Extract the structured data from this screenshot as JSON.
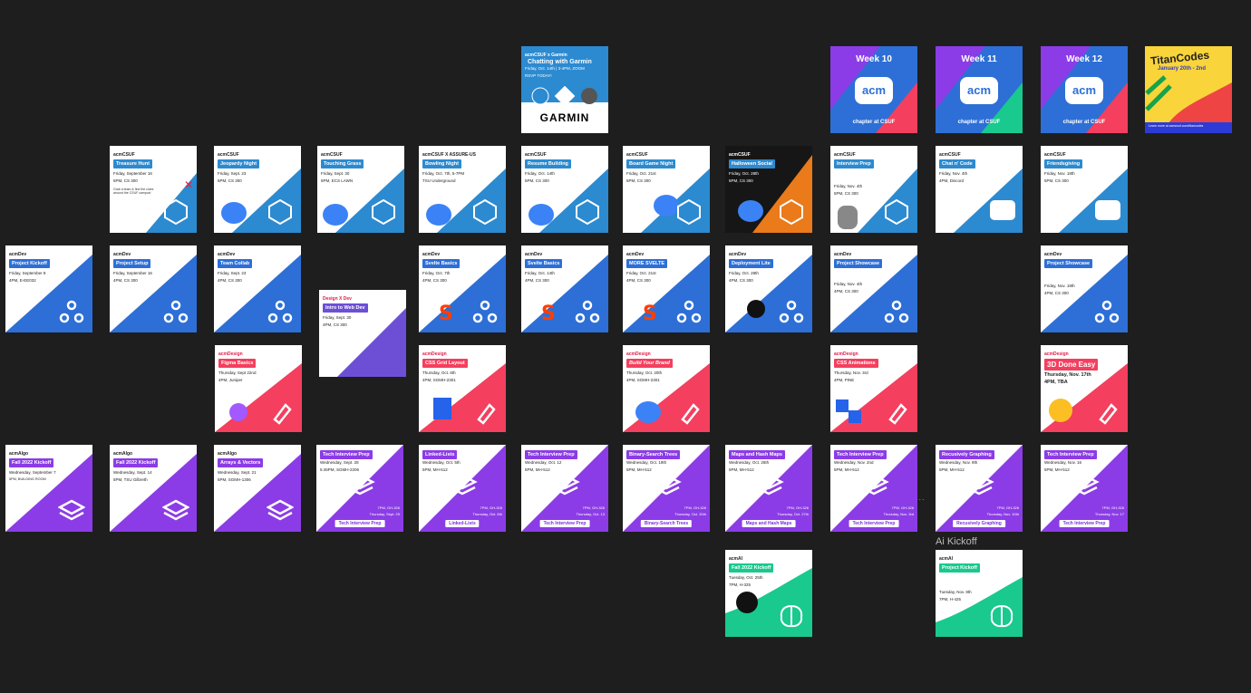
{
  "canvas": {
    "background": "#1e1e1e"
  },
  "selection_label": "Ai Kickoff",
  "more_indicator": "...",
  "colors": {
    "csuf": "#2c8ad0",
    "dev": "#2d6fd6",
    "design": "#f43f5e",
    "algo": "#8b3ce6",
    "ai": "#19c98d"
  },
  "frames": {
    "garmin": {
      "hdr": "acmCSUF x Garmin",
      "title": "Chatting with Garmin",
      "l1": "Friday, Oct. 14th | 3-4PM, ZOOM",
      "l2": "RSVP TODAY!",
      "brand": "GARMIN"
    },
    "week10": {
      "week": "Week 10",
      "mark": "acm",
      "chapter": "chapter at CSUF"
    },
    "week11": {
      "week": "Week 11",
      "mark": "acm",
      "chapter": "chapter at CSUF"
    },
    "week12": {
      "week": "Week 12",
      "mark": "acm",
      "chapter": "chapter at CSUF"
    },
    "titancodes": {
      "title": "TitanCodes",
      "sub": "January 20th - 2nd",
      "cap": "Learn more at acmcsuf.com/titancodes"
    },
    "csuf1": {
      "hdr": "acmCSUF",
      "title": "Treasure Hunt",
      "l1": "Friday, September 16",
      "l2": "5PM, CS 300",
      "l3": "Grab a team & find the clues around the CSUF campus!"
    },
    "csuf2": {
      "hdr": "acmCSUF",
      "title": "Jeopardy Night",
      "l1": "Friday, Sept. 23",
      "l2": "5PM, CS 300"
    },
    "csuf3": {
      "hdr": "acmCSUF",
      "title": "Touching Grass",
      "l1": "Friday, Sept. 30",
      "l2": "5PM, ECS LAWN"
    },
    "csuf4": {
      "hdr": "acmCSUF X ASSURE-US",
      "title": "Bowling Night",
      "l1": "Friday, Oct. 7th, 5-7PM",
      "l2": "TSU Underground"
    },
    "csuf5": {
      "hdr": "acmCSUF",
      "title": "Resume Building",
      "l1": "Friday, Oct. 14th",
      "l2": "5PM, CS 300"
    },
    "csuf6": {
      "hdr": "acmCSUF",
      "title": "Board Game Night",
      "l1": "Friday, Oct. 21st",
      "l2": "5PM, CS 300"
    },
    "csuf7": {
      "hdr": "acmCSUF",
      "title": "Halloween Social",
      "l1": "Friday, Oct. 28th",
      "l2": "5PM, CS 300"
    },
    "csuf8": {
      "hdr": "acmCSUF",
      "title": "Interview Prep",
      "l1": "Friday, Nov. 4th",
      "l2": "5PM, CS 300"
    },
    "csuf9": {
      "hdr": "acmCSUF",
      "title": "Chat n' Code",
      "l1": "Friday, Nov. 4th",
      "l2": "4PM, Discord"
    },
    "csuf10": {
      "hdr": "acmCSUF",
      "title": "Friendsgiving",
      "l1": "Friday, Nov. 18th",
      "l2": "5PM, CS 300"
    },
    "dev1": {
      "hdr": "acmDev",
      "title": "Project Kickoff",
      "l1": "Friday, September 9",
      "l2": "4PM, E-EE032"
    },
    "dev2": {
      "hdr": "acmDev",
      "title": "Project Setup",
      "l1": "Friday, September 16",
      "l2": "4PM, CS 300"
    },
    "dev3": {
      "hdr": "acmDev",
      "title": "Team Collab",
      "l1": "Friday, Sept. 23",
      "l2": "4PM, CS 300"
    },
    "dev4": {
      "hdr": "Design X Dev",
      "title": "Intro to Web Dev",
      "l1": "Friday, Sept. 30",
      "l2": "4PM, CS 300"
    },
    "dev5": {
      "hdr": "acmDev",
      "title": "Svelte Basics",
      "l1": "Friday, Oct. 7th",
      "l2": "4PM, CS 300"
    },
    "dev6": {
      "hdr": "acmDev",
      "title": "Svelte Basics",
      "l1": "Friday, Oct. 14th",
      "l2": "4PM, CS 300"
    },
    "dev7": {
      "hdr": "acmDev",
      "title": "MORE SVELTE",
      "l1": "Friday, Oct. 21st",
      "l2": "4PM, CS 300"
    },
    "dev8": {
      "hdr": "acmDev",
      "title": "Deployment Lite",
      "l1": "Friday, Oct. 28th",
      "l2": "4PM, CS 300"
    },
    "dev9": {
      "hdr": "acmDev",
      "title": "Project Showcase",
      "l1": "Friday, Nov. 4th",
      "l2": "4PM, CS 300"
    },
    "dev10": {
      "hdr": "acmDev",
      "title": "Project Showcase",
      "l1": "Friday, Nov. 18th",
      "l2": "4PM, CS 300"
    },
    "des1": {
      "hdr": "acmDesign",
      "title": "Figma Basics",
      "l1": "Thursday, Sept 22nd",
      "l2": "4PM, Juniper"
    },
    "des2": {
      "hdr": "acmDesign",
      "title": "CSS Grid Layout",
      "l1": "Thursday, Oct. 6th",
      "l2": "4PM, SGMH-2301"
    },
    "des3": {
      "hdr": "acmDesign",
      "title": "Build Your Brand",
      "l1": "Thursday, Oct. 20th",
      "l2": "4PM, SGMH-2301"
    },
    "des4": {
      "hdr": "acmDesign",
      "title": "CSS Animations",
      "l1": "Thursday, Nov. 3rd",
      "l2": "4PM, PINE"
    },
    "des5": {
      "hdr": "acmDesign",
      "title": "3D Done Easy",
      "l1": "Thursday, Nov. 17th",
      "l2": "4PM, TBA"
    },
    "alg1": {
      "hdr": "acmAlgo",
      "title": "Fall 2022 Kickoff",
      "l1": "Wednesday, September 7",
      "l2": "5PM, BUILDING ROOM"
    },
    "alg2": {
      "hdr": "acmAlgo",
      "title": "Fall 2022 Kickoff",
      "l1": "Wednesday, Sept. 14",
      "l2": "5PM, TSU Gilbreth"
    },
    "alg3": {
      "hdr": "acmAlgo",
      "title": "Arrays & Vectors",
      "l1": "Wednesday, Sept. 21",
      "l2": "5PM, SGMH-1306"
    },
    "alg4": {
      "hdr": "acmAlgo",
      "title": "Tech Interview Prep",
      "l1": "Wednesday, Sept. 28",
      "l2": "5:45PM, SGMH-2206",
      "f1": "7PM, GH-326",
      "f2": "Thursday, Sept. 29",
      "pill": "Tech Interview Prep"
    },
    "alg5": {
      "hdr": "acmAlgo",
      "title": "Linked-Lists",
      "l1": "Wednesday, Oct. 5th",
      "l2": "5PM, MH-512",
      "f1": "7PM, GH-326",
      "f2": "Thursday, Oct. 6th",
      "pill": "Linked-Lists"
    },
    "alg6": {
      "hdr": "acmAlgo",
      "title": "Tech Interview Prep",
      "l1": "Wednesday, Oct. 12",
      "l2": "5PM, MH-512",
      "f1": "7PM, GH-326",
      "f2": "Thursday, Oct. 13",
      "pill": "Tech Interview Prep"
    },
    "alg7": {
      "hdr": "acmAlgo",
      "title": "Binary-Search Trees",
      "l1": "Wednesday, Oct. 19th",
      "l2": "5PM, MH-512",
      "f1": "7PM, GH-326",
      "f2": "Thursday, Oct. 20th",
      "pill": "Binary-Search Trees"
    },
    "alg8": {
      "hdr": "acmAlgo",
      "title": "Maps and Hash Maps",
      "l1": "Wednesday, Oct. 26th",
      "l2": "5PM, MH-512",
      "f1": "7PM, GH-326",
      "f2": "Thursday, Oct. 27th",
      "pill": "Maps and Hash Maps"
    },
    "alg9": {
      "hdr": "acmAlgo",
      "title": "Tech Interview Prep",
      "l1": "Wednesday, Nov. 2nd",
      "l2": "5PM, MH-512",
      "f1": "7PM, GH-326",
      "f2": "Thursday, Nov. 3rd",
      "pill": "Tech Interview Prep"
    },
    "alg10": {
      "hdr": "acmAlgo",
      "title": "Recusively Graphing",
      "l1": "Wednesday, Nov. 9th",
      "l2": "5PM, MH-512",
      "f1": "7PM, GH-326",
      "f2": "Thursday, Nov. 10th",
      "pill": "Recusively Graphing"
    },
    "alg11": {
      "hdr": "acmAlgo",
      "title": "Tech Interview Prep",
      "l1": "Wednesday, Nov. 16",
      "l2": "5PM, MH-512",
      "f1": "7PM, GH-326",
      "f2": "Thursday, Nov. 17",
      "pill": "Tech Interview Prep"
    },
    "ai1": {
      "hdr": "acmAI",
      "title": "Fall 2022 Kickoff",
      "l1": "Tuesday, Oct. 25th",
      "l2": "7PM, H-325"
    },
    "ai2": {
      "hdr": "acmAI",
      "title": "Project Kickoff",
      "l1": "Tuesday, Nov. 8th",
      "l2": "7PM, H-425"
    }
  }
}
